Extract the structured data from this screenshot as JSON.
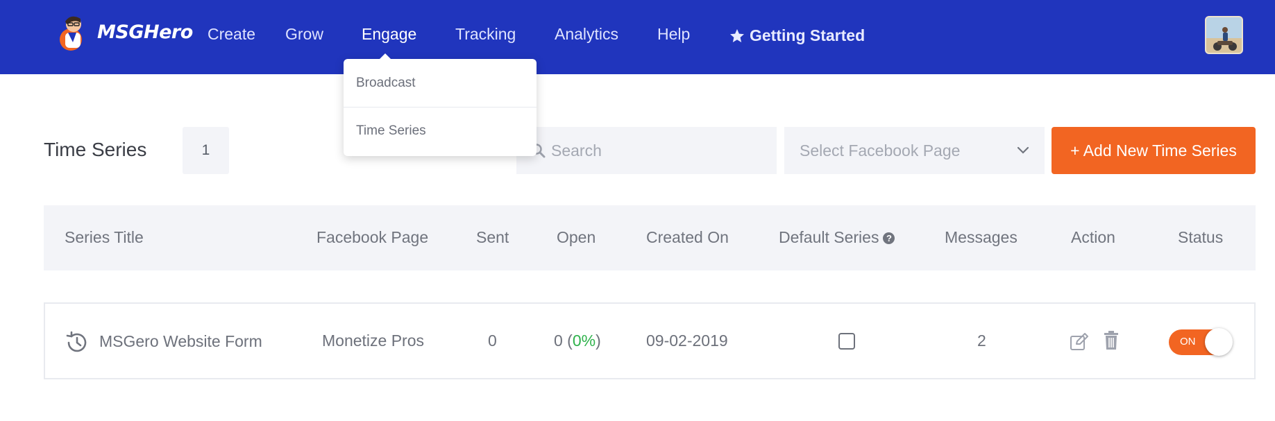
{
  "app": {
    "brand": "MSGHero"
  },
  "nav": {
    "items": [
      {
        "label": "Create"
      },
      {
        "label": "Grow"
      },
      {
        "label": "Engage"
      },
      {
        "label": "Tracking"
      },
      {
        "label": "Analytics"
      },
      {
        "label": "Help"
      }
    ],
    "active": "Engage",
    "getting_started": "Getting Started"
  },
  "dropdown": {
    "items": [
      {
        "label": "Broadcast"
      },
      {
        "label": "Time Series"
      }
    ]
  },
  "toolbar": {
    "title": "Time Series",
    "count": "1",
    "search_placeholder": "Search",
    "select_page_placeholder": "Select Facebook Page",
    "add_button_label": "+ Add New Time Series"
  },
  "table": {
    "columns": [
      "Series Title",
      "Facebook Page",
      "Sent",
      "Open",
      "Created On",
      "Default Series",
      "Messages",
      "Action",
      "Status"
    ],
    "rows": [
      {
        "title": "MSGero Website Form",
        "facebook_page": "Monetize Pros",
        "sent": "0",
        "open": "0",
        "open_pct": "0%",
        "created_on": "09-02-2019",
        "default_series": false,
        "messages": "2",
        "status": "ON"
      }
    ]
  },
  "colors": {
    "nav_bg": "#2035bd",
    "accent": "#f26522",
    "open_pct": "#2fb24c"
  },
  "icons": {
    "getting_started": "star-icon",
    "row_series": "clock-history-icon",
    "edit": "edit-icon",
    "delete": "trash-icon",
    "search": "search-icon",
    "select": "chevron-down-icon",
    "help": "question-circle-icon"
  }
}
